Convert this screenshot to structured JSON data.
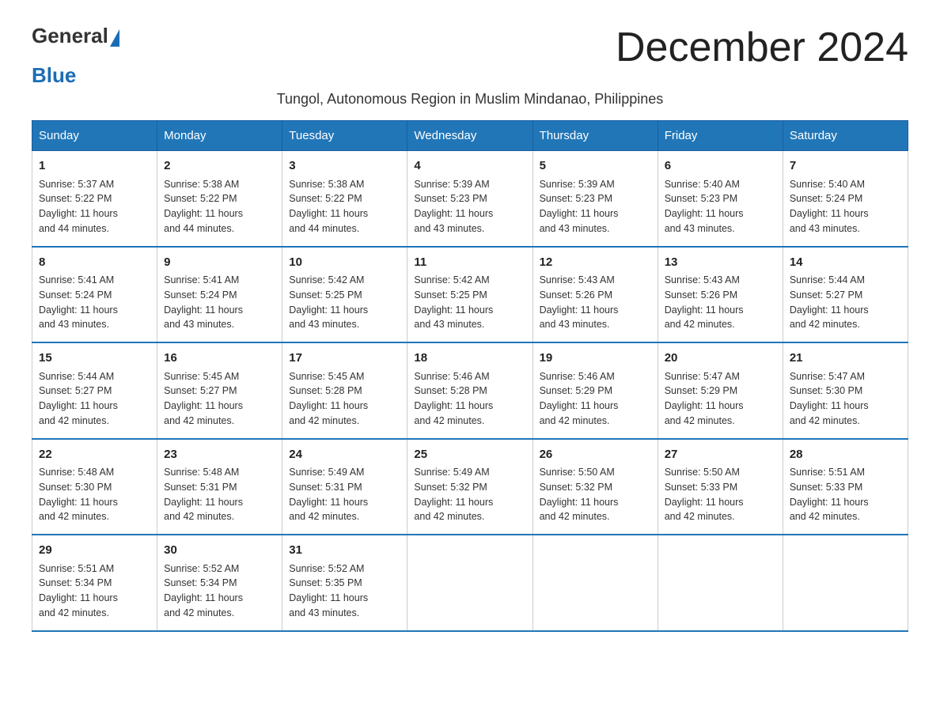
{
  "logo": {
    "general": "General",
    "blue": "Blue"
  },
  "title": "December 2024",
  "subtitle": "Tungol, Autonomous Region in Muslim Mindanao, Philippines",
  "weekdays": [
    "Sunday",
    "Monday",
    "Tuesday",
    "Wednesday",
    "Thursday",
    "Friday",
    "Saturday"
  ],
  "weeks": [
    [
      {
        "day": "1",
        "sunrise": "5:37 AM",
        "sunset": "5:22 PM",
        "daylight": "11 hours and 44 minutes."
      },
      {
        "day": "2",
        "sunrise": "5:38 AM",
        "sunset": "5:22 PM",
        "daylight": "11 hours and 44 minutes."
      },
      {
        "day": "3",
        "sunrise": "5:38 AM",
        "sunset": "5:22 PM",
        "daylight": "11 hours and 44 minutes."
      },
      {
        "day": "4",
        "sunrise": "5:39 AM",
        "sunset": "5:23 PM",
        "daylight": "11 hours and 43 minutes."
      },
      {
        "day": "5",
        "sunrise": "5:39 AM",
        "sunset": "5:23 PM",
        "daylight": "11 hours and 43 minutes."
      },
      {
        "day": "6",
        "sunrise": "5:40 AM",
        "sunset": "5:23 PM",
        "daylight": "11 hours and 43 minutes."
      },
      {
        "day": "7",
        "sunrise": "5:40 AM",
        "sunset": "5:24 PM",
        "daylight": "11 hours and 43 minutes."
      }
    ],
    [
      {
        "day": "8",
        "sunrise": "5:41 AM",
        "sunset": "5:24 PM",
        "daylight": "11 hours and 43 minutes."
      },
      {
        "day": "9",
        "sunrise": "5:41 AM",
        "sunset": "5:24 PM",
        "daylight": "11 hours and 43 minutes."
      },
      {
        "day": "10",
        "sunrise": "5:42 AM",
        "sunset": "5:25 PM",
        "daylight": "11 hours and 43 minutes."
      },
      {
        "day": "11",
        "sunrise": "5:42 AM",
        "sunset": "5:25 PM",
        "daylight": "11 hours and 43 minutes."
      },
      {
        "day": "12",
        "sunrise": "5:43 AM",
        "sunset": "5:26 PM",
        "daylight": "11 hours and 43 minutes."
      },
      {
        "day": "13",
        "sunrise": "5:43 AM",
        "sunset": "5:26 PM",
        "daylight": "11 hours and 42 minutes."
      },
      {
        "day": "14",
        "sunrise": "5:44 AM",
        "sunset": "5:27 PM",
        "daylight": "11 hours and 42 minutes."
      }
    ],
    [
      {
        "day": "15",
        "sunrise": "5:44 AM",
        "sunset": "5:27 PM",
        "daylight": "11 hours and 42 minutes."
      },
      {
        "day": "16",
        "sunrise": "5:45 AM",
        "sunset": "5:27 PM",
        "daylight": "11 hours and 42 minutes."
      },
      {
        "day": "17",
        "sunrise": "5:45 AM",
        "sunset": "5:28 PM",
        "daylight": "11 hours and 42 minutes."
      },
      {
        "day": "18",
        "sunrise": "5:46 AM",
        "sunset": "5:28 PM",
        "daylight": "11 hours and 42 minutes."
      },
      {
        "day": "19",
        "sunrise": "5:46 AM",
        "sunset": "5:29 PM",
        "daylight": "11 hours and 42 minutes."
      },
      {
        "day": "20",
        "sunrise": "5:47 AM",
        "sunset": "5:29 PM",
        "daylight": "11 hours and 42 minutes."
      },
      {
        "day": "21",
        "sunrise": "5:47 AM",
        "sunset": "5:30 PM",
        "daylight": "11 hours and 42 minutes."
      }
    ],
    [
      {
        "day": "22",
        "sunrise": "5:48 AM",
        "sunset": "5:30 PM",
        "daylight": "11 hours and 42 minutes."
      },
      {
        "day": "23",
        "sunrise": "5:48 AM",
        "sunset": "5:31 PM",
        "daylight": "11 hours and 42 minutes."
      },
      {
        "day": "24",
        "sunrise": "5:49 AM",
        "sunset": "5:31 PM",
        "daylight": "11 hours and 42 minutes."
      },
      {
        "day": "25",
        "sunrise": "5:49 AM",
        "sunset": "5:32 PM",
        "daylight": "11 hours and 42 minutes."
      },
      {
        "day": "26",
        "sunrise": "5:50 AM",
        "sunset": "5:32 PM",
        "daylight": "11 hours and 42 minutes."
      },
      {
        "day": "27",
        "sunrise": "5:50 AM",
        "sunset": "5:33 PM",
        "daylight": "11 hours and 42 minutes."
      },
      {
        "day": "28",
        "sunrise": "5:51 AM",
        "sunset": "5:33 PM",
        "daylight": "11 hours and 42 minutes."
      }
    ],
    [
      {
        "day": "29",
        "sunrise": "5:51 AM",
        "sunset": "5:34 PM",
        "daylight": "11 hours and 42 minutes."
      },
      {
        "day": "30",
        "sunrise": "5:52 AM",
        "sunset": "5:34 PM",
        "daylight": "11 hours and 42 minutes."
      },
      {
        "day": "31",
        "sunrise": "5:52 AM",
        "sunset": "5:35 PM",
        "daylight": "11 hours and 43 minutes."
      },
      null,
      null,
      null,
      null
    ]
  ],
  "labels": {
    "sunrise": "Sunrise:",
    "sunset": "Sunset:",
    "daylight": "Daylight:"
  }
}
